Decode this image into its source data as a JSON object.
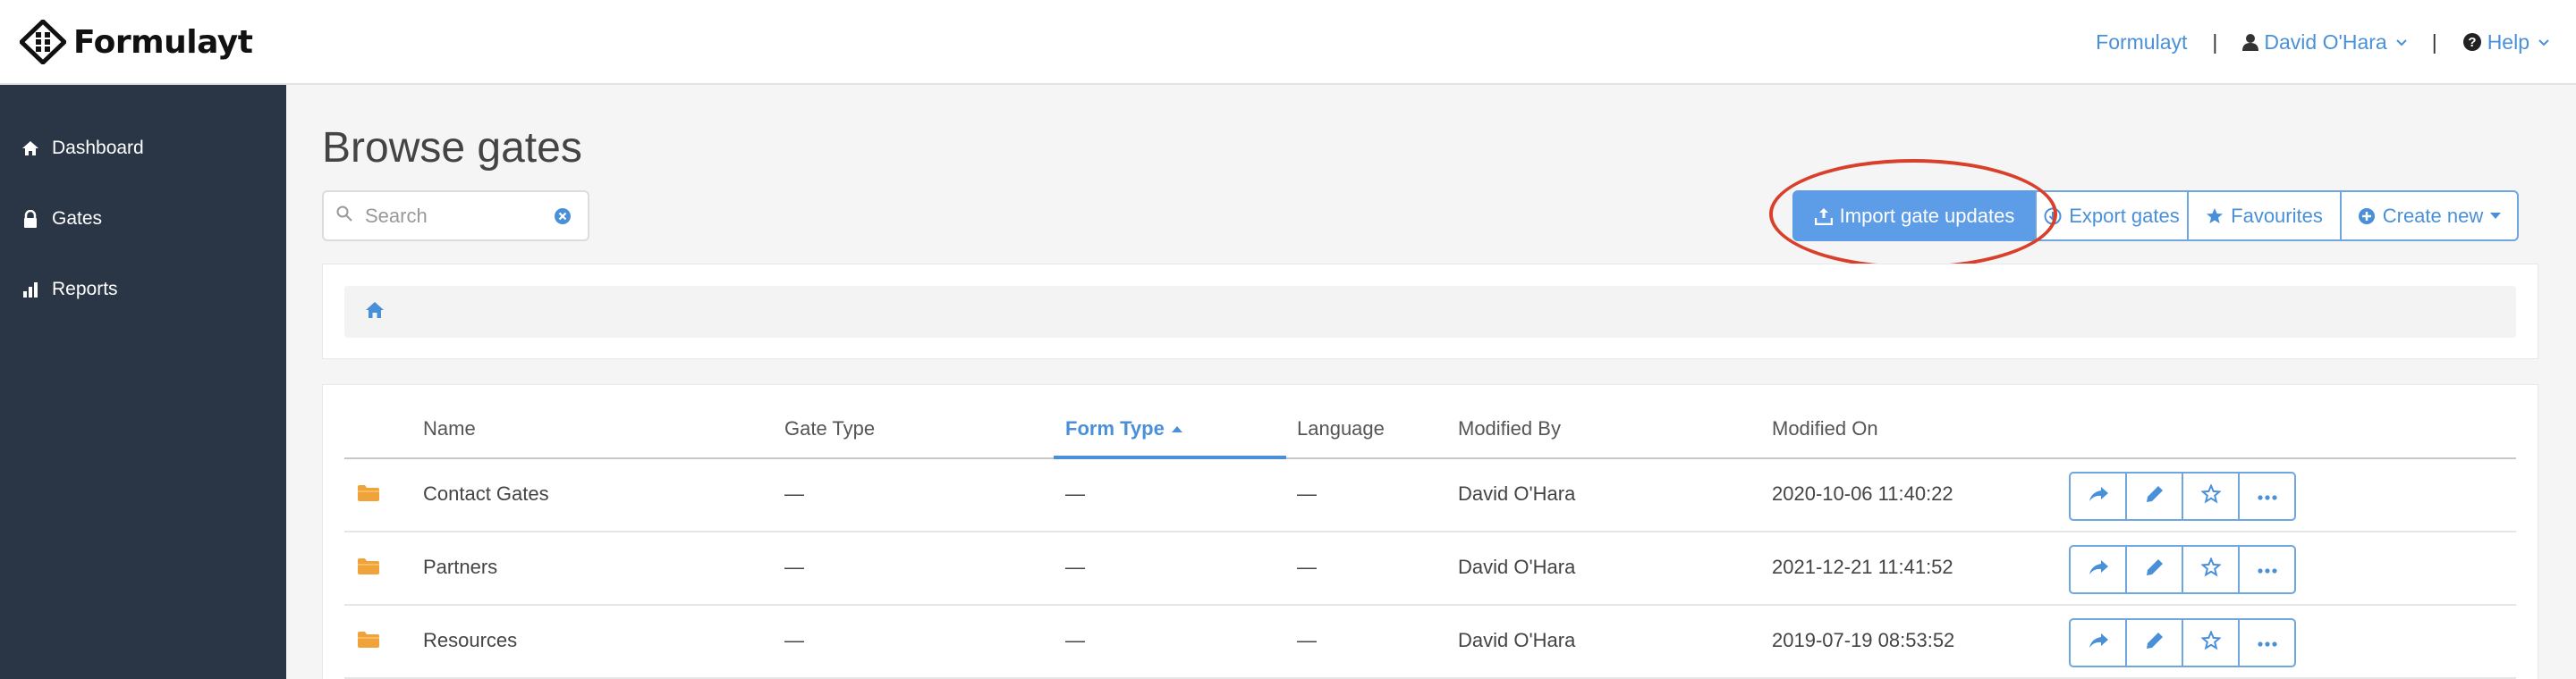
{
  "app": {
    "name": "Formulayt"
  },
  "topnav": {
    "org": "Formulayt",
    "user": "David O'Hara",
    "help": "Help"
  },
  "sidebar": {
    "items": [
      {
        "label": "Dashboard",
        "icon": "home-icon"
      },
      {
        "label": "Gates",
        "icon": "lock-icon"
      },
      {
        "label": "Reports",
        "icon": "bar-chart-icon"
      }
    ]
  },
  "page": {
    "title": "Browse gates",
    "search_placeholder": "Search"
  },
  "toolbar": {
    "import_label": "Import gate updates",
    "export_label": "Export gates",
    "favourites_label": "Favourites",
    "create_label": "Create new"
  },
  "colors": {
    "accent": "#4a90d9",
    "sidebar": "#2a3646",
    "folder": "#f0a23b",
    "highlight": "#d9402b"
  },
  "table": {
    "columns": [
      "Name",
      "Gate Type",
      "Form Type",
      "Language",
      "Modified By",
      "Modified On"
    ],
    "sorted_column": "Form Type",
    "sort_direction": "ascending",
    "rows": [
      {
        "name": "Contact Gates",
        "gate_type": "—",
        "form_type": "—",
        "language": "—",
        "modified_by": "David O'Hara",
        "modified_on": "2020-10-06 11:40:22"
      },
      {
        "name": "Partners",
        "gate_type": "—",
        "form_type": "—",
        "language": "—",
        "modified_by": "David O'Hara",
        "modified_on": "2021-12-21 11:41:52"
      },
      {
        "name": "Resources",
        "gate_type": "—",
        "form_type": "—",
        "language": "—",
        "modified_by": "David O'Hara",
        "modified_on": "2019-07-19 08:53:52"
      }
    ]
  }
}
